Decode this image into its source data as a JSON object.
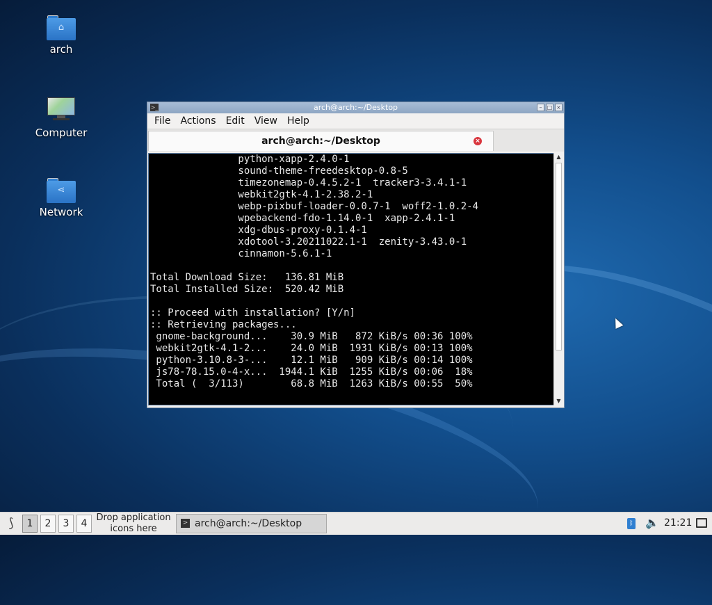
{
  "desktop": {
    "icons": [
      {
        "label": "arch",
        "icon": "home-folder-icon"
      },
      {
        "label": "Computer",
        "icon": "computer-icon"
      },
      {
        "label": "Network",
        "icon": "network-folder-icon"
      }
    ]
  },
  "window": {
    "title": "arch@arch:~/Desktop",
    "menu": [
      "File",
      "Actions",
      "Edit",
      "View",
      "Help"
    ],
    "tab_label": "arch@arch:~/Desktop",
    "terminal_lines": [
      "               python-xapp-2.4.0-1",
      "               sound-theme-freedesktop-0.8-5",
      "               timezonemap-0.4.5.2-1  tracker3-3.4.1-1",
      "               webkit2gtk-4.1-2.38.2-1",
      "               webp-pixbuf-loader-0.0.7-1  woff2-1.0.2-4",
      "               wpebackend-fdo-1.14.0-1  xapp-2.4.1-1",
      "               xdg-dbus-proxy-0.1.4-1",
      "               xdotool-3.20211022.1-1  zenity-3.43.0-1",
      "               cinnamon-5.6.1-1",
      "",
      "Total Download Size:   136.81 MiB",
      "Total Installed Size:  520.42 MiB",
      "",
      ":: Proceed with installation? [Y/n]",
      ":: Retrieving packages...",
      " gnome-background...    30.9 MiB   872 KiB/s 00:36 100%",
      " webkit2gtk-4.1-2...    24.0 MiB  1931 KiB/s 00:13 100%",
      " python-3.10.8-3-...    12.1 MiB   909 KiB/s 00:14 100%",
      " js78-78.15.0-4-x...  1944.1 KiB  1255 KiB/s 00:06  18%",
      " Total (  3/113)        68.8 MiB  1263 KiB/s 00:55  50%"
    ]
  },
  "taskbar": {
    "workspaces": [
      "1",
      "2",
      "3",
      "4"
    ],
    "active_workspace": "1",
    "drop_text_line1": "Drop application",
    "drop_text_line2": "icons here",
    "task_label": "arch@arch:~/Desktop",
    "clock": "21:21"
  }
}
